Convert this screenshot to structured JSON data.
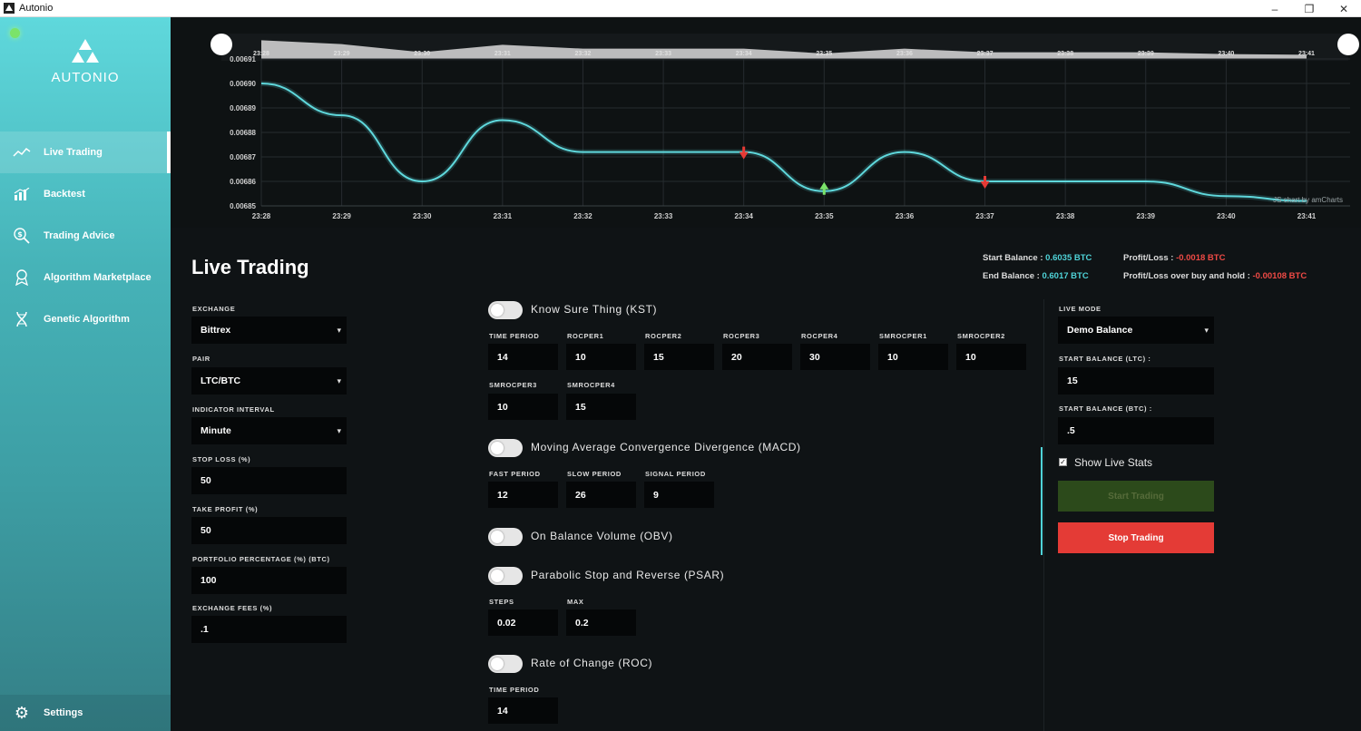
{
  "window": {
    "title": "Autonio",
    "minimize": "–",
    "restore": "❐",
    "close": "✕"
  },
  "sidebar": {
    "logo": "AUTONIO",
    "items": [
      {
        "label": "Live Trading",
        "icon": "line-chart-icon",
        "active": true
      },
      {
        "label": "Backtest",
        "icon": "bar-chart-icon",
        "active": false
      },
      {
        "label": "Trading Advice",
        "icon": "dollar-search-icon",
        "active": false
      },
      {
        "label": "Algorithm Marketplace",
        "icon": "badge-icon",
        "active": false
      },
      {
        "label": "Genetic Algorithm",
        "icon": "dna-icon",
        "active": false
      }
    ],
    "settings": {
      "label": "Settings",
      "icon": "gear-icon"
    }
  },
  "chart_data": {
    "type": "line",
    "x": [
      "23:28",
      "23:29",
      "23:30",
      "23:31",
      "23:32",
      "23:33",
      "23:34",
      "23:35",
      "23:36",
      "23:37",
      "23:38",
      "23:39",
      "23:40",
      "23:41"
    ],
    "series": [
      {
        "values": [
          0.0069,
          0.006887,
          0.00686,
          0.006885,
          0.006872,
          0.006872,
          0.006872,
          0.006856,
          0.006872,
          0.00686,
          0.00686,
          0.00686,
          0.006854,
          0.006852
        ]
      }
    ],
    "yticks": [
      "0.00685",
      "0.00686",
      "0.00687",
      "0.00688",
      "0.00689",
      "0.00690",
      "0.00691"
    ],
    "ylim": [
      0.00685,
      0.00691
    ],
    "markers": [
      {
        "x": "23:34",
        "type": "sell"
      },
      {
        "x": "23:35",
        "type": "buy"
      },
      {
        "x": "23:37",
        "type": "sell"
      }
    ],
    "credit": "JS chart by amCharts",
    "line_color": "#5fd8dc",
    "grid": true
  },
  "main": {
    "title": "Live Trading",
    "stats": {
      "start_balance_label": "Start Balance :",
      "start_balance_value": "0.6035 BTC",
      "end_balance_label": "End Balance :",
      "end_balance_value": "0.6017 BTC",
      "pl_label": "Profit/Loss :",
      "pl_value": "-0.0018 BTC",
      "plbh_label": "Profit/Loss over buy and hold :",
      "plbh_value": "-0.00108 BTC"
    },
    "left": {
      "exchange_label": "Exchange",
      "exchange_value": "Bittrex",
      "pair_label": "Pair",
      "pair_value": "LTC/BTC",
      "interval_label": "Indicator Interval",
      "interval_value": "Minute",
      "stoploss_label": "Stop Loss (%)",
      "stoploss_value": "50",
      "takeprofit_label": "Take Profit (%)",
      "takeprofit_value": "50",
      "portfolio_label": "Portfolio Percentage (%) (BTC)",
      "portfolio_value": "100",
      "fees_label": "Exchange Fees (%)",
      "fees_value": ".1"
    },
    "indicators": {
      "kst": {
        "title": "Know Sure Thing (KST)",
        "fields": [
          {
            "label": "Time Period",
            "value": "14"
          },
          {
            "label": "ROCPER1",
            "value": "10"
          },
          {
            "label": "ROCPER2",
            "value": "15"
          },
          {
            "label": "ROCPER3",
            "value": "20"
          },
          {
            "label": "ROCPER4",
            "value": "30"
          },
          {
            "label": "SMROCPER1",
            "value": "10"
          },
          {
            "label": "SMROCPER2",
            "value": "10"
          },
          {
            "label": "SMROCPER3",
            "value": "10"
          },
          {
            "label": "SMROCPER4",
            "value": "15"
          }
        ]
      },
      "macd": {
        "title": "Moving Average Convergence Divergence (MACD)",
        "fields": [
          {
            "label": "Fast Period",
            "value": "12"
          },
          {
            "label": "Slow Period",
            "value": "26"
          },
          {
            "label": "Signal Period",
            "value": "9"
          }
        ]
      },
      "obv": {
        "title": "On Balance Volume (OBV)"
      },
      "psar": {
        "title": "Parabolic Stop and Reverse (PSAR)",
        "fields": [
          {
            "label": "Steps",
            "value": "0.02"
          },
          {
            "label": "Max",
            "value": "0.2"
          }
        ]
      },
      "roc": {
        "title": "Rate of Change (ROC)",
        "fields": [
          {
            "label": "Time Period",
            "value": "14"
          }
        ]
      }
    },
    "right": {
      "mode_label": "Live Mode",
      "mode_value": "Demo Balance",
      "ltc_label": "Start Balance (LTC) :",
      "ltc_value": "15",
      "btc_label": "Start Balance (BTC) :",
      "btc_value": ".5",
      "show_stats_label": "Show Live Stats",
      "start_btn": "Start Trading",
      "stop_btn": "Stop Trading"
    }
  }
}
